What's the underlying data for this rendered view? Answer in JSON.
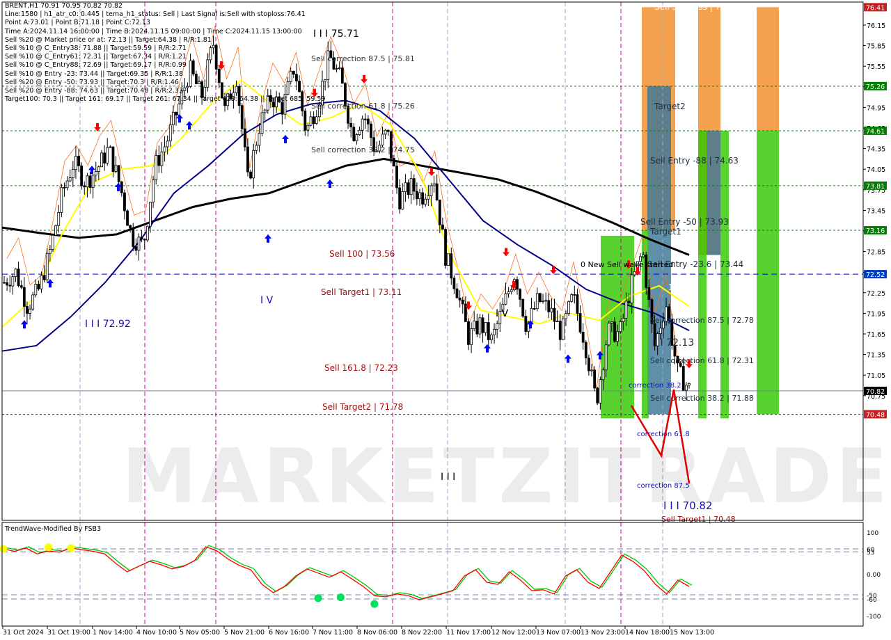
{
  "header": {
    "symbol_line": "BRENT,H1  70.91 70.95 70.82 70.82",
    "info_lines": [
      "Line:1580 | h1_atr_c0: 0.445 | tema_h1_status: Sell | Last Signal is:Sell with stoploss:76.41",
      "Point A:73.01 | Point B:71.18 | Point C:72.13",
      "Time A:2024.11.14 16:00:00 | Time B:2024.11.15 09:00:00 | Time C:2024.11.15 13:00:00",
      "Sell %20 @ Market price or at: 72.13 || Target:64.38 | R/R:1.81",
      "Sell %10 @ C_Entry38: 71.88 || Target:59.59 | R/R:2.71",
      "Sell %10 @ C_Entry61: 72.31 || Target:67.34 | R/R:1.21",
      "Sell %10 @ C_Entry88: 72.69 || Target:69.17 | R/R:0.99",
      "Sell %10 @ Entry -23: 73.44 || Target:69.35 | R/R:1.38",
      "Sell %20 @ Entry -50: 73.93 || Target:70.3 | R/R:1.46",
      "Sell %20 @ Entry -88: 74.63 || Target:70.48 | R/R:2.33",
      "Target100: 70.3 || Target 161: 69.17 || Target 261: 67.34 || Target 423: 64.38 || Target 685: 59.59"
    ]
  },
  "indicator": {
    "title": "TrendWave-Modified By FSB3"
  },
  "colors": {
    "grid": "#c0c0c0",
    "candle": "#000000",
    "ema_slow": "#000000",
    "ema_mid": "#00008b",
    "tema": "#ffff00",
    "level_green": "#008000",
    "level_blue": "#0000c8",
    "level_red": "#c80000",
    "zone_orange": "#f08c28",
    "zone_teal": "#3c7896",
    "zone_green": "#32c800",
    "osc_red": "#ff0000",
    "osc_green": "#00c800",
    "buy_arrow": "#0000ff",
    "sell_arrow": "#ff0000"
  },
  "chart_data": {
    "type": "candlestick",
    "symbol": "BRENT",
    "timeframe": "H1",
    "ylim": [
      70.48,
      76.41
    ],
    "y_ticks": [
      "76.15",
      "75.85",
      "75.55",
      "75.25",
      "74.95",
      "74.65",
      "74.35",
      "74.05",
      "73.75",
      "73.45",
      "73.15",
      "72.85",
      "72.55",
      "72.25",
      "71.95",
      "71.65",
      "71.35",
      "71.05",
      "70.75"
    ],
    "x_ticks": [
      "31 Oct 2024",
      "31 Oct 19:00",
      "1 Nov 14:00",
      "4 Nov 10:00",
      "5 Nov 05:00",
      "5 Nov 21:00",
      "6 Nov 16:00",
      "7 Nov 11:00",
      "8 Nov 06:00",
      "8 Nov 22:00",
      "11 Nov 17:00",
      "12 Nov 12:00",
      "13 Nov 07:00",
      "13 Nov 23:00",
      "14 Nov 18:00",
      "15 Nov 13:00"
    ],
    "price_path": [
      72.4,
      72.55,
      72.05,
      72.3,
      72.88,
      73.7,
      74.15,
      73.85,
      74.05,
      74.35,
      73.8,
      73.05,
      72.95,
      74.1,
      74.45,
      74.95,
      75.5,
      75.1,
      75.9,
      74.9,
      75.4,
      73.85,
      74.7,
      75.1,
      74.95,
      75.55,
      74.6,
      75.0,
      75.7,
      75.35,
      74.55,
      74.85,
      74.3,
      74.6,
      73.6,
      73.8,
      73.65,
      73.95,
      72.8,
      72.3,
      71.6,
      71.8,
      71.55,
      72.05,
      72.55,
      71.75,
      72.15,
      72.0,
      71.65,
      72.2,
      71.55,
      70.65,
      71.7,
      71.65,
      72.35,
      72.85,
      71.45,
      72.1,
      71.1,
      70.85
    ],
    "series": [
      {
        "name": "EMA slow",
        "values": [
          73.2,
          73.12,
          73.05,
          73.1,
          73.3,
          73.5,
          73.62,
          73.7,
          73.9,
          74.1,
          74.2,
          74.1,
          74.0,
          73.9,
          73.72,
          73.5,
          73.27,
          73.02,
          72.8
        ]
      },
      {
        "name": "EMA mid",
        "values": [
          71.4,
          71.48,
          71.9,
          72.4,
          73.0,
          73.7,
          74.1,
          74.55,
          74.85,
          75.0,
          75.05,
          74.9,
          74.5,
          73.9,
          73.3,
          72.95,
          72.65,
          72.3,
          72.1,
          71.95,
          71.7
        ]
      },
      {
        "name": "TEMA",
        "values": [
          71.75,
          72.15,
          73.1,
          73.85,
          74.05,
          74.1,
          74.5,
          75.0,
          75.35,
          75.0,
          74.7,
          74.8,
          75.0,
          74.7,
          74.0,
          72.8,
          72.0,
          71.9,
          71.8,
          71.95,
          71.85,
          72.2,
          72.35,
          72.05
        ]
      }
    ],
    "price_labels": [
      {
        "text": "76.41",
        "level": 76.41,
        "style": "red"
      },
      {
        "text": "75.26",
        "level": 75.26,
        "style": "green"
      },
      {
        "text": "74.61",
        "level": 74.61,
        "style": "green"
      },
      {
        "text": "73.81",
        "level": 73.81,
        "style": "green"
      },
      {
        "text": "73.16",
        "level": 73.16,
        "style": "green"
      },
      {
        "text": "72.52",
        "level": 72.52,
        "style": "blue"
      },
      {
        "text": "70.82",
        "level": 70.82,
        "style": "black"
      },
      {
        "text": "70.48",
        "level": 70.48,
        "style": "red"
      }
    ],
    "annotations": [
      "I I I 75.71",
      "Sell correction 87.5 | 75.81",
      "Sell correction 61.8 | 75.26",
      "Sell correction 38.2 | 74.75",
      "Sell 100 | 73.56",
      "Sell Target1 | 73.11",
      "Sell 161.8 | 72.23",
      "Sell Target2 | 71.78",
      "I I I 72.92",
      "I V",
      "I V",
      "I I I",
      "Sell Stoploss | 76.41",
      "Target2",
      "Sell Entry -88 | 74.63",
      "Sell Entry -50 | 73.93",
      "Target1",
      "Sell Entry -23.6 | 73.44",
      "0 New Sell wave started",
      "100",
      "Sell correction 87.5 | 72.78",
      "I I 72.13",
      "Sell correction 61.8 | 72.31",
      "Sell correction 38.2 | 71.88",
      "correction 38.2",
      "correction 61.8",
      "correction 87.5",
      "I I I 70.82",
      "Sell Target1 | 70.48"
    ],
    "oscillator": {
      "title": "TrendWave-Modified By FSB3",
      "ylim": [
        -100,
        100
      ],
      "y_ticks": [
        "100",
        "60",
        "53",
        "0.00",
        "-50",
        "-60",
        "-100"
      ],
      "values": [
        60,
        54,
        62,
        48,
        55,
        52,
        62,
        58,
        54,
        48,
        25,
        5,
        18,
        30,
        22,
        12,
        18,
        32,
        65,
        55,
        35,
        20,
        10,
        -25,
        -45,
        -30,
        -5,
        12,
        2,
        -8,
        5,
        -12,
        -30,
        -52,
        -55,
        -48,
        -52,
        -62,
        -55,
        -48,
        -40,
        -5,
        10,
        -20,
        -25,
        5,
        -15,
        -40,
        -38,
        -48,
        -5,
        10,
        -20,
        -35,
        5,
        45,
        30,
        8,
        -25,
        -48,
        -15,
        -30
      ],
      "dots_high": [
        {
          "i": 0,
          "v": 60
        },
        {
          "i": 4,
          "v": 64
        },
        {
          "i": 6,
          "v": 62
        }
      ],
      "dots_low": [
        {
          "i": 28,
          "v": -58
        },
        {
          "i": 30,
          "v": -56
        },
        {
          "i": 33,
          "v": -72
        }
      ]
    }
  }
}
